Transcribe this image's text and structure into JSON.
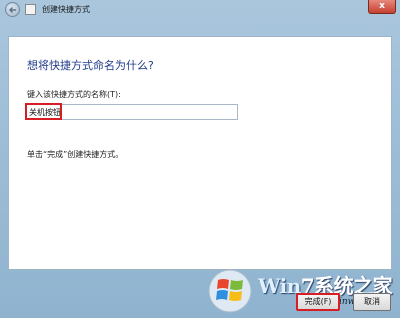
{
  "window": {
    "title": "创建快捷方式",
    "close_label": "x"
  },
  "page": {
    "heading": "想将快捷方式命名为什么?",
    "field_label": "键入该快捷方式的名称(T):",
    "name_value": "关机按钮",
    "hint": "单击“完成”创建快捷方式。"
  },
  "buttons": {
    "finish": "完成(F)",
    "cancel": "取消"
  },
  "watermark": {
    "brand_w": "Win",
    "brand_rest": "7系统之家",
    "site": "www.Winwin7.com"
  },
  "colors": {
    "accent_red": "#d81e24",
    "heading_blue": "#1f3a8a"
  }
}
